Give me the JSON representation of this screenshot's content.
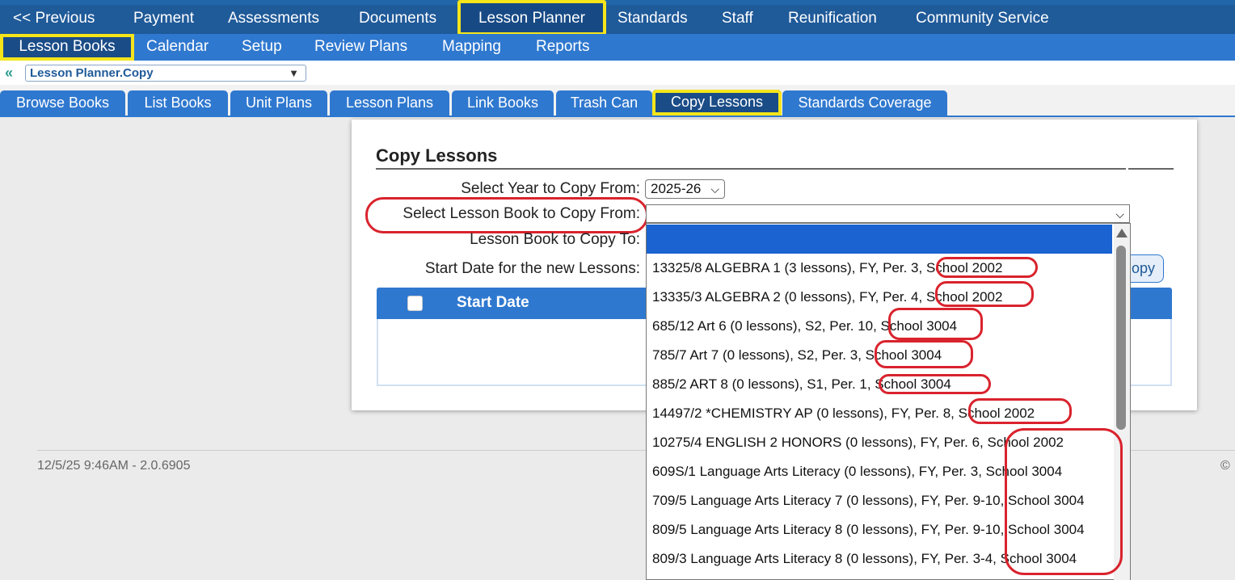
{
  "top_nav": {
    "items": [
      "<< Previous",
      "Payment",
      "Assessments",
      "Documents",
      "Lesson Planner",
      "Standards",
      "Staff",
      "Reunification",
      "Community Service"
    ]
  },
  "sub_nav": {
    "items": [
      "Lesson Books",
      "Calendar",
      "Setup",
      "Review Plans",
      "Mapping",
      "Reports"
    ]
  },
  "module_select": {
    "value": "Lesson Planner.Copy"
  },
  "tabs": [
    "Browse Books",
    "List Books",
    "Unit Plans",
    "Lesson Plans",
    "Link Books",
    "Trash Can",
    "Copy Lessons",
    "Standards Coverage"
  ],
  "copy_lessons": {
    "title": "Copy Lessons",
    "year_label": "Select Year to Copy From:",
    "year_value": "2025-26",
    "book_from_label": "Select Lesson Book to Copy From:",
    "book_to_label": "Lesson Book to Copy To:",
    "start_date_label": "Start Date for the new Lessons:",
    "copy_button": "opy",
    "table_header": "Start Date"
  },
  "dropdown_options": [
    "",
    "13325/8 ALGEBRA 1 (3 lessons), FY, Per. 3, School 2002",
    "13335/3 ALGEBRA 2 (0 lessons), FY, Per. 4, School 2002",
    "685/12 Art 6 (0 lessons), S2, Per. 10, School 3004",
    "785/7 Art 7 (0 lessons), S2, Per. 3, School 3004",
    "885/2 ART 8 (0 lessons), S1, Per. 1, School 3004",
    "14497/2 *CHEMISTRY AP (0 lessons), FY, Per. 8, School 2002",
    "10275/4 ENGLISH 2 HONORS (0 lessons), FY, Per. 6, School 2002",
    "609S/1 Language Arts Literacy (0 lessons), FY, Per. 3, School 3004",
    "709/5 Language Arts Literacy 7 (0 lessons), FY, Per. 9-10, School 3004",
    "809/5 Language Arts Literacy 8 (0 lessons), FY, Per. 9-10, School 3004",
    "809/3 Language Arts Literacy 8 (0 lessons), FY, Per. 3-4, School 3004"
  ],
  "footer": {
    "timestamp": "12/5/25 9:46AM - 2.0.6905",
    "copyright": "©"
  },
  "colors": {
    "nav_dark": "#1f5a99",
    "nav_light": "#2f78cf",
    "highlight_yellow": "#f5e51a",
    "annotation_red": "#d9232d",
    "selected_option": "#1a63d0"
  }
}
